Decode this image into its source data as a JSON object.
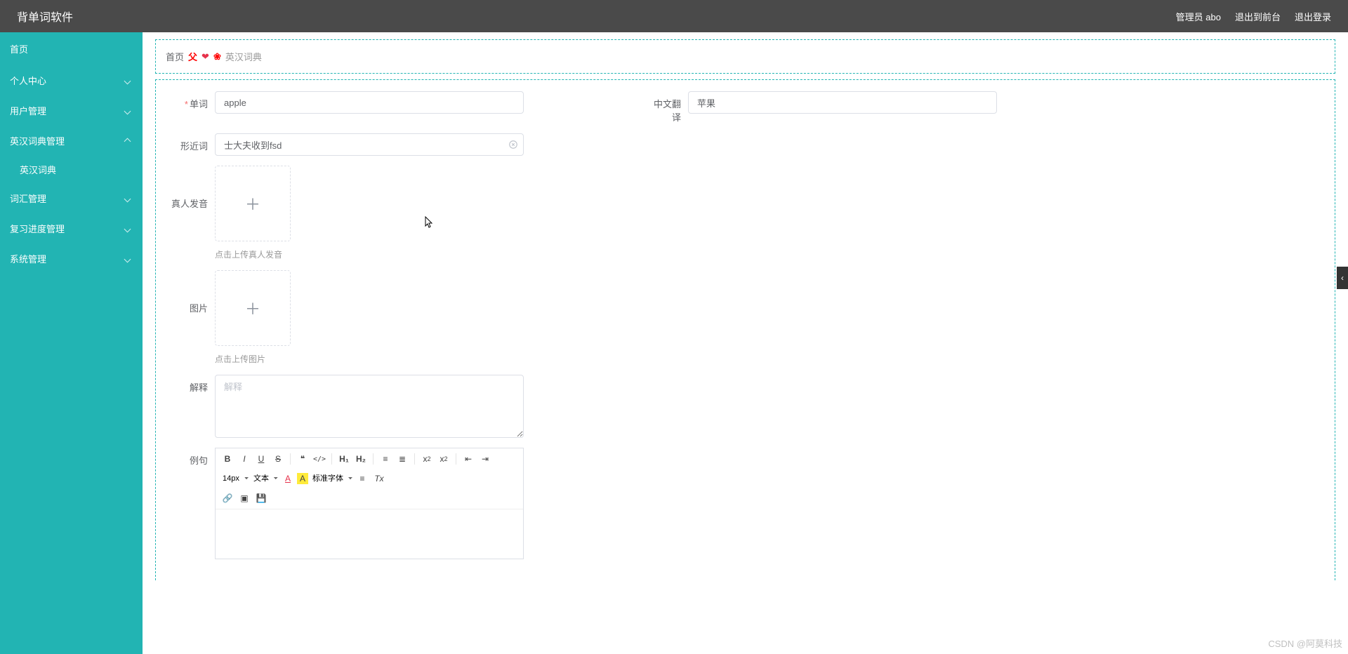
{
  "header": {
    "title": "背单词软件",
    "links": {
      "admin": "管理员 abo",
      "front": "退出到前台",
      "logout": "退出登录"
    }
  },
  "sidebar": {
    "home": "首页",
    "items": [
      {
        "label": "个人中心",
        "expanded": false
      },
      {
        "label": "用户管理",
        "expanded": false
      },
      {
        "label": "英汉词典管理",
        "expanded": true,
        "children": [
          {
            "label": "英汉词典"
          }
        ]
      },
      {
        "label": "词汇管理",
        "expanded": false
      },
      {
        "label": "复习进度管理",
        "expanded": false
      },
      {
        "label": "系统管理",
        "expanded": false
      }
    ]
  },
  "breadcrumb": {
    "home": "首页",
    "sep1": "父",
    "sep2": "❤",
    "sep3": "❀",
    "current": "英汉词典"
  },
  "form": {
    "word_label": "单词",
    "word_value": "apple",
    "translation_label": "中文翻译",
    "translation_value": "苹果",
    "similar_label": "形近词",
    "similar_value": "士大夫收到fsd",
    "audio_label": "真人发音",
    "audio_hint": "点击上传真人发音",
    "image_label": "图片",
    "image_hint": "点击上传图片",
    "explain_label": "解释",
    "explain_placeholder": "解释",
    "example_label": "例句"
  },
  "editor_toolbar": {
    "bold": "B",
    "italic": "I",
    "underline": "U",
    "strike": "S",
    "quote": "❝",
    "code": "</>",
    "h1": "H₁",
    "h2": "H₂",
    "ol": "≡",
    "ul": "≣",
    "sub": "x",
    "sub2": "2",
    "sup": "x",
    "sup2": "2",
    "outdent": "⇤",
    "indent": "⇥",
    "size_select": "14px",
    "header_select": "文本",
    "font_select": "标准字体",
    "color": "A",
    "bgcolor": "A",
    "align": "≡",
    "clean": "Tx",
    "link": "🔗",
    "image": "▣",
    "video": "💾"
  },
  "watermark": "CSDN @阿莫科技"
}
